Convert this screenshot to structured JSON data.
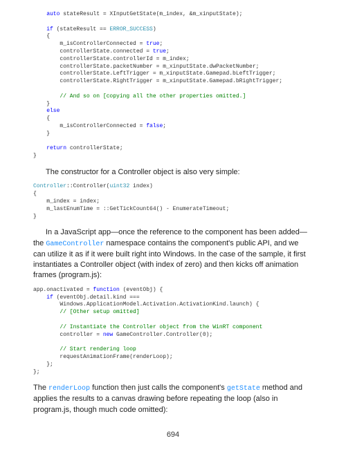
{
  "code1": {
    "l1a": "auto",
    "l1b": " stateResult = XInputGetState(m_index, &m_xinputState);",
    "l2a": "if",
    "l2b": " (stateResult == ",
    "l2c": "ERROR_SUCCESS",
    "l2d": ")",
    "l3": "{",
    "l4a": "    m_isControllerConnected = ",
    "l4b": "true",
    "l4c": ";",
    "l5a": "    controllerState.connected = ",
    "l5b": "true",
    "l5c": ";",
    "l6": "    controllerState.controllerId = m_index;",
    "l7": "    controllerState.packetNumber = m_xinputState.dwPacketNumber;",
    "l8": "    controllerState.LeftTrigger = m_xinputState.Gamepad.bLeftTrigger;",
    "l9": "    controllerState.RightTrigger = m_xinputState.Gamepad.bRightTrigger;",
    "l10": "// And so on [copying all the other properties omitted.]",
    "l11": "}",
    "l12": "else",
    "l13": "{",
    "l14a": "    m_isControllerConnected = ",
    "l14b": "false",
    "l14c": ";",
    "l15": "}",
    "l16a": "return",
    "l16b": " controllerState;",
    "l17": "}"
  },
  "para1": "The constructor for a Controller object is also very simple:",
  "code2": {
    "l1a": "Controller",
    "l1b": "::Controller(",
    "l1c": "uint32",
    "l1d": " index)",
    "l2": "{",
    "l3a": "    m_index = ",
    "l3b": "index",
    "l3c": ";",
    "l4": "    m_lastEnumTime = ::GetTickCount64() - EnumerateTimeout;",
    "l5": "}"
  },
  "para2a": "In a JavaScript app—once the reference to the component has been added—the ",
  "para2b": "GameController",
  "para2c": " namespace contains the component's public API, and we can utilize it as if it were built right into Windows. In the case of the sample, it first instantiates a Controller object (with index of zero) and then kicks off animation frames (program.js):",
  "code3": {
    "l1a": "app.onactivated = ",
    "l1b": "function",
    "l1c": " (eventObj) {",
    "l2a": "    ",
    "l2b": "if",
    "l2c": " (eventObj.detail.kind ===",
    "l3": "        Windows.ApplicationModel.Activation.ActivationKind.launch) {",
    "l4": "// [Other setup omitted]",
    "l5": "// Instantiate the Controller object from the WinRT component",
    "l6a": "        controller = ",
    "l6b": "new",
    "l6c": " GameController.Controller(0);",
    "l7": "// Start rendering loop",
    "l8": "        requestAnimationFrame(renderLoop);",
    "l9": "    };",
    "l10": "};"
  },
  "para3a": "The ",
  "para3b": "renderLoop",
  "para3c": " function then just calls the component's ",
  "para3d": "getState",
  "para3e": " method and applies the results to a canvas drawing before repeating the loop (also in program.js, though much code omitted):",
  "pageNumber": "694"
}
